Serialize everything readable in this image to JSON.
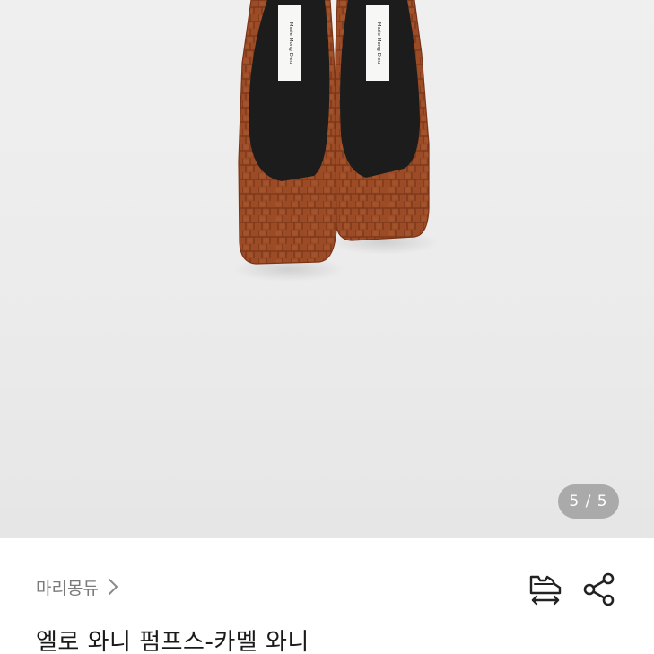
{
  "gallery": {
    "image_alt": "Caramel croc-embossed square-toe pumps",
    "insole_label": "Marie Mong Dieu",
    "page_indicator": "5 / 5",
    "current_page": 5,
    "total_pages": 5
  },
  "product": {
    "brand": "마리몽듀",
    "title": "엘로 와니 펌프스-카멜 와니"
  },
  "icons": {
    "brand_chevron": "chevron-right-icon",
    "size_guide": "shoe-size-icon",
    "share": "share-icon"
  },
  "colors": {
    "background": "#ffffff",
    "photo_background": "#ececec",
    "leather": "#9a4a24",
    "insole": "#1c1c1c",
    "brand_text": "#7a7a7a",
    "title_text": "#1a1a1a"
  }
}
